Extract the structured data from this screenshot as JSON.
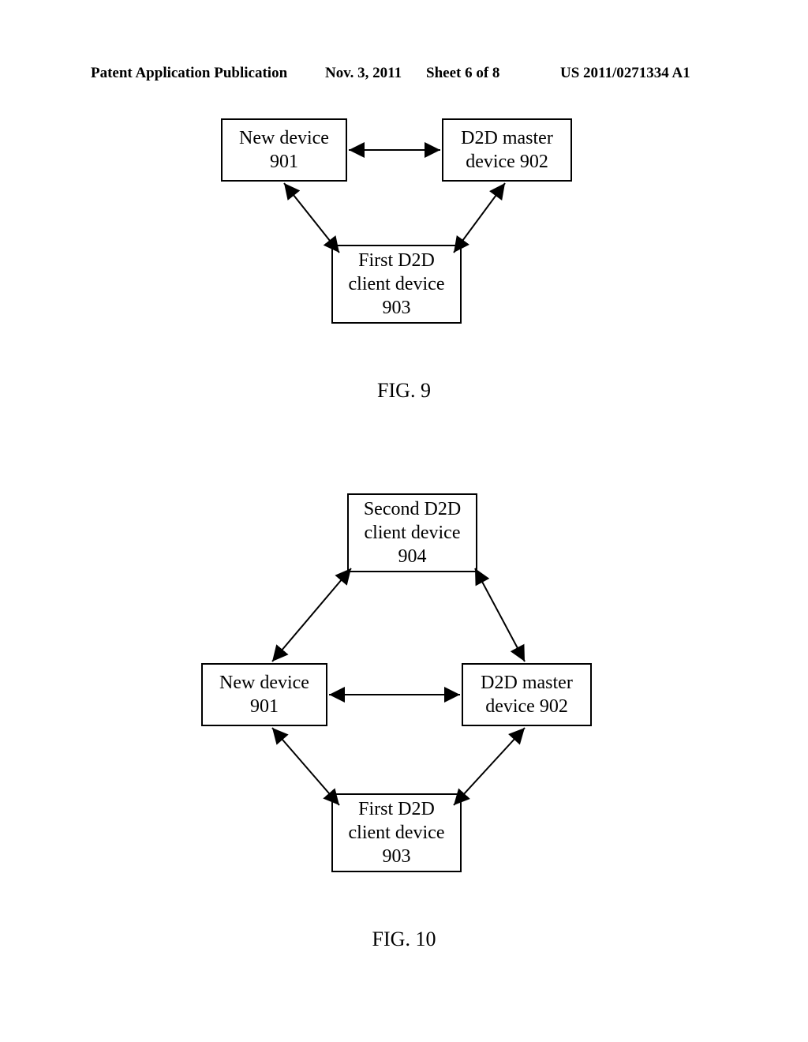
{
  "header": {
    "left": "Patent Application Publication",
    "mid_date": "Nov. 3, 2011",
    "mid_sheet": "Sheet 6 of 8",
    "right": "US 2011/0271334 A1"
  },
  "fig9": {
    "box901_l1": "New device",
    "box901_l2": "901",
    "box902_l1": "D2D master",
    "box902_l2": "device 902",
    "box903_l1": "First D2D",
    "box903_l2": "client device",
    "box903_l3": "903",
    "label": "FIG. 9"
  },
  "fig10": {
    "box904_l1": "Second D2D",
    "box904_l2": "client device",
    "box904_l3": "904",
    "box901_l1": "New device",
    "box901_l2": "901",
    "box902_l1": "D2D master",
    "box902_l2": "device 902",
    "box903_l1": "First D2D",
    "box903_l2": "client device",
    "box903_l3": "903",
    "label": "FIG. 10"
  }
}
